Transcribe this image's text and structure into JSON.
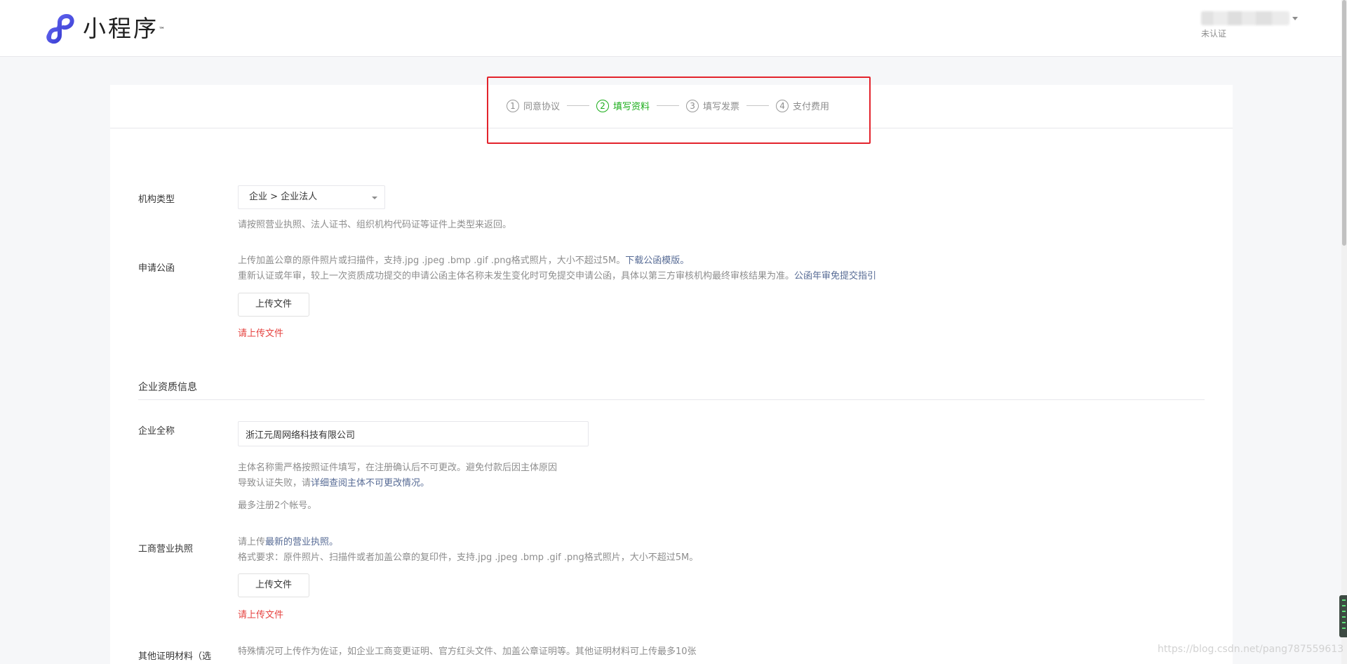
{
  "header": {
    "logo_text": "小程序",
    "logo_tm": "™",
    "account_status": "未认证"
  },
  "steps": [
    {
      "num": "1",
      "label": "同意协议",
      "active": false
    },
    {
      "num": "2",
      "label": "填写资料",
      "active": true
    },
    {
      "num": "3",
      "label": "填写发票",
      "active": false
    },
    {
      "num": "4",
      "label": "支付费用",
      "active": false
    }
  ],
  "org_type": {
    "label": "机构类型",
    "value": "企业 > 企业法人",
    "tip": "请按照营业执照、法人证书、组织机构代码证等证件上类型来返回。"
  },
  "letter": {
    "label": "申请公函",
    "tip1": "上传加盖公章的原件照片或扫描件，支持.jpg .jpeg .bmp .gif .png格式照片，大小不超过5M。",
    "tip1_link": "下载公函模版。",
    "tip2": "重新认证或年审，较上一次资质成功提交的申请公函主体名称未发生变化时可免提交申请公函，具体以第三方审核机构最终审核结果为准。",
    "tip2_link": "公函年审免提交指引",
    "upload_label": "上传文件",
    "error": "请上传文件"
  },
  "section_title": "企业资质信息",
  "company_name": {
    "label": "企业全称",
    "value": "浙江元周网络科技有限公司",
    "tip1": "主体名称需严格按照证件填写，在注册确认后不可更改。避免付款后因主体原因",
    "tip2": "导致认证失败，请",
    "tip2_link": "详细查阅主体不可更改情况。",
    "tip3": "最多注册2个帐号。"
  },
  "license": {
    "label": "工商营业执照",
    "tip1": "请上传",
    "tip1_link": "最新的营业执照。",
    "tip2": "格式要求：原件照片、扫描件或者加盖公章的复印件，支持.jpg .jpeg .bmp .gif .png格式照片，大小不超过5M。",
    "upload_label": "上传文件",
    "error": "请上传文件"
  },
  "other": {
    "label": "其他证明材料（选",
    "tip": "特殊情况可上传作为佐证，如企业工商变更证明、官方红头文件、加盖公章证明等。其他证明材料可上传最多10张"
  },
  "watermark": "https://blog.csdn.net/pang787559613"
}
